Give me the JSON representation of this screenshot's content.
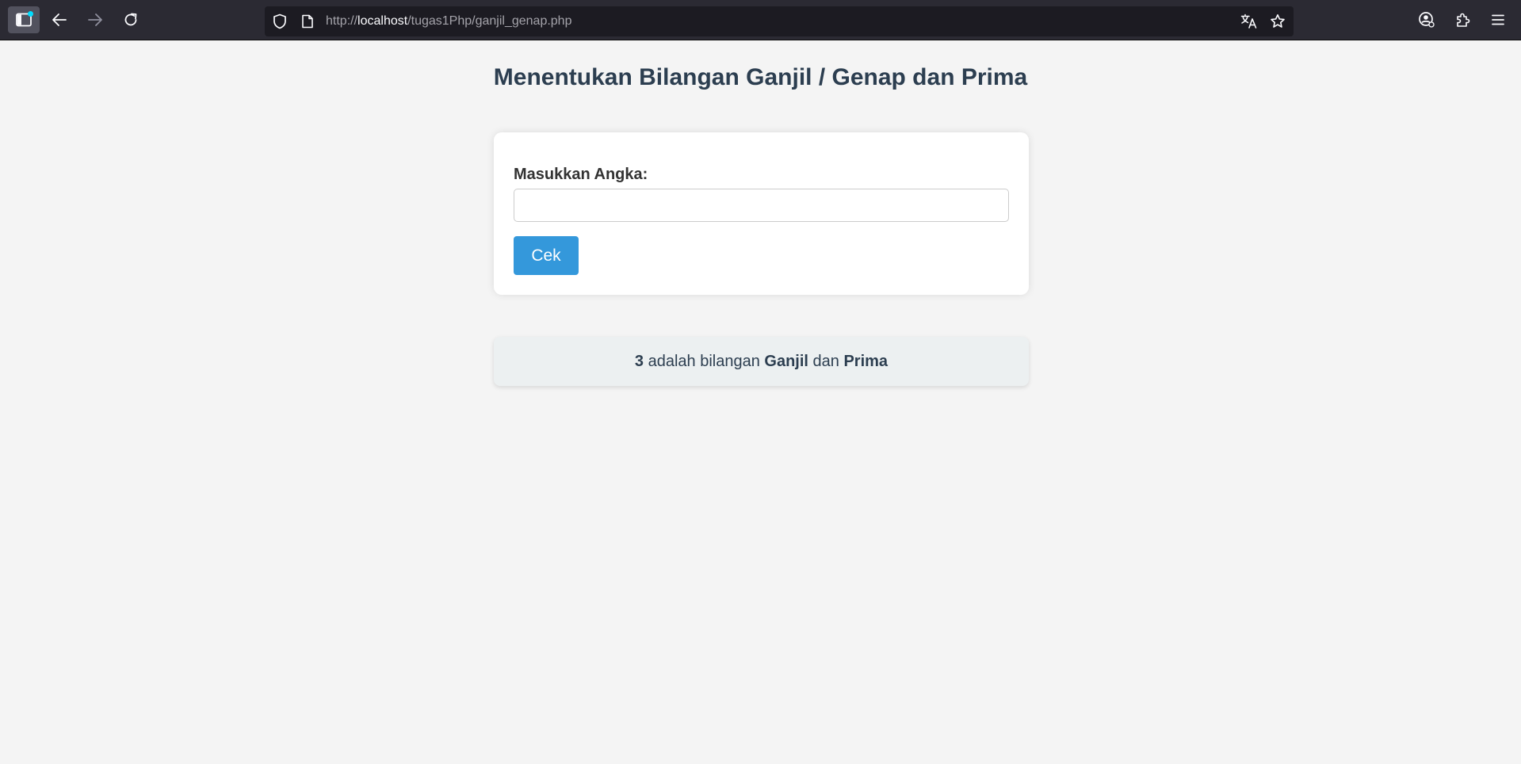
{
  "browser": {
    "toolbar_icons": {
      "sidebar": "sidebar-icon",
      "back": "back-arrow-icon",
      "forward": "forward-arrow-icon",
      "reload": "reload-icon",
      "shield": "tracking-protection-shield-icon",
      "page": "page-info-icon",
      "translate": "translate-icon",
      "bookmark": "bookmark-star-icon",
      "account": "account-icon",
      "extensions": "extensions-puzzle-icon",
      "menu": "hamburger-menu-icon"
    },
    "url": {
      "scheme": "http://",
      "host": "localhost",
      "path": "/tugas1Php/ganjil_genap.php"
    },
    "colors": {
      "toolbar_bg": "#2b2a33",
      "urlbar_bg": "#1c1b22",
      "accent_dot": "#00ddff"
    }
  },
  "page": {
    "title": "Menentukan Bilangan Ganjil / Genap dan Prima",
    "form": {
      "label": "Masukkan Angka:",
      "input_value": "",
      "button_label": "Cek"
    },
    "result": {
      "number": "3",
      "text_1": " adalah bilangan ",
      "parity": "Ganjil",
      "text_2": " dan ",
      "prime": "Prima"
    },
    "colors": {
      "background": "#f4f4f4",
      "title": "#2c3e50",
      "button": "#3498db",
      "result_bg": "#ecf0f1"
    }
  }
}
